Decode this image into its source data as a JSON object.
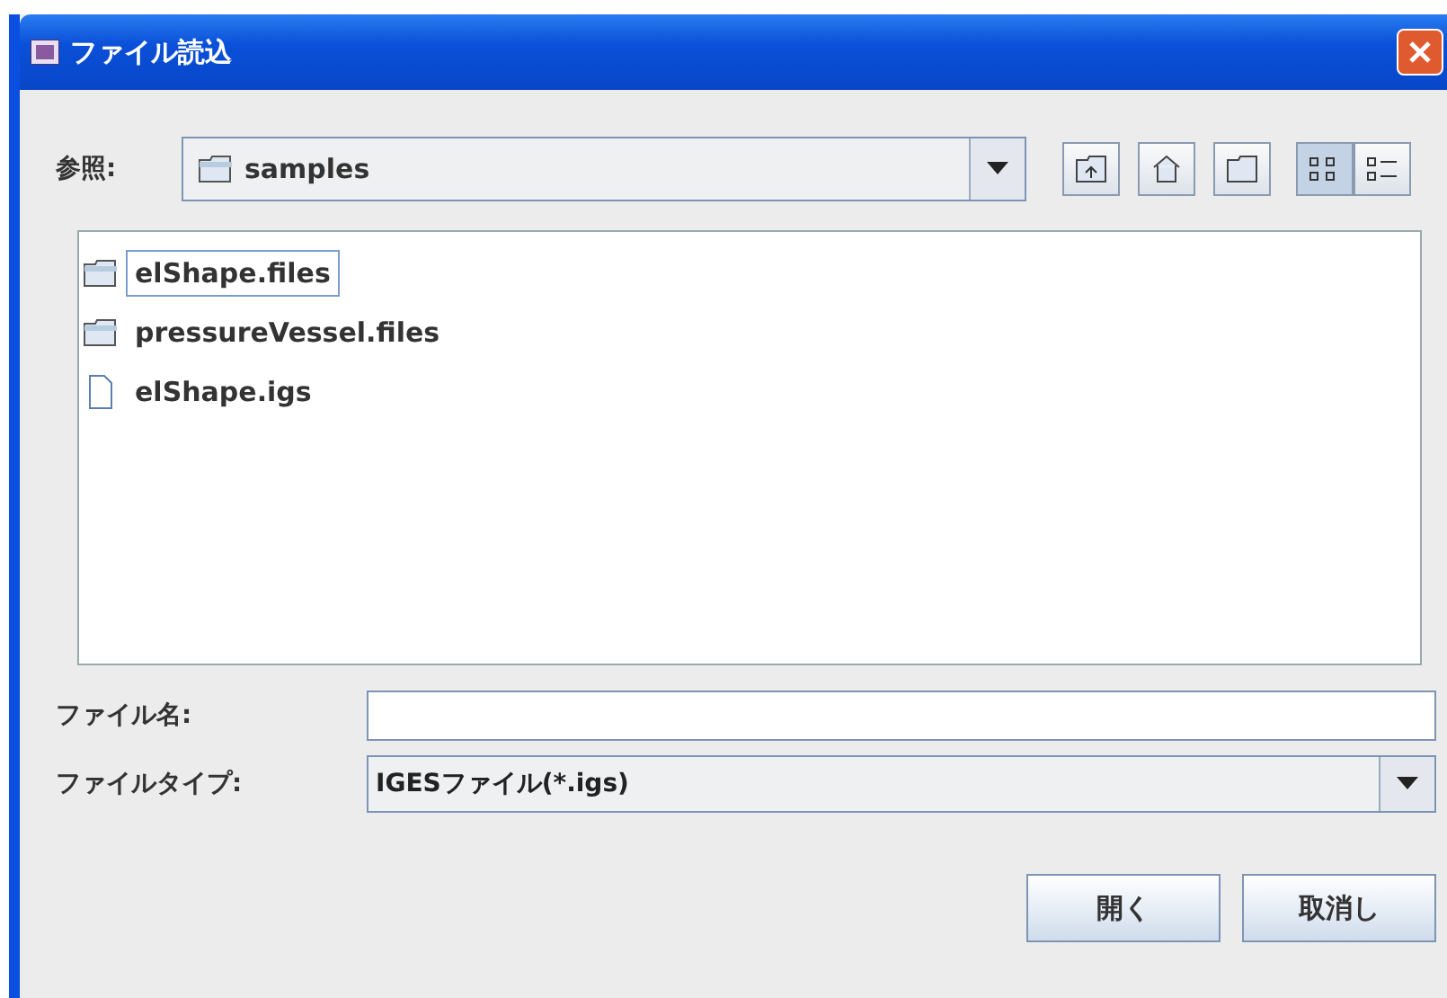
{
  "window": {
    "title": "ファイル読込"
  },
  "look_in": {
    "label": "参照:",
    "value": "samples"
  },
  "toolbar": [
    {
      "kind": "up"
    },
    {
      "kind": "home"
    },
    {
      "kind": "new-folder"
    },
    {
      "kind": "list",
      "selected": true
    },
    {
      "kind": "details",
      "selected": false
    }
  ],
  "files": [
    {
      "name": "elShape.files",
      "kind": "folder",
      "selected": true
    },
    {
      "name": "pressureVessel.files",
      "kind": "folder",
      "selected": false
    },
    {
      "name": "elShape.igs",
      "kind": "file",
      "selected": false
    }
  ],
  "file_name": {
    "label": "ファイル名:"
  },
  "file_type": {
    "label": "ファイルタイプ:",
    "value": "IGESファイル(*.igs)"
  },
  "buttons": [
    "開く",
    "取消し"
  ]
}
